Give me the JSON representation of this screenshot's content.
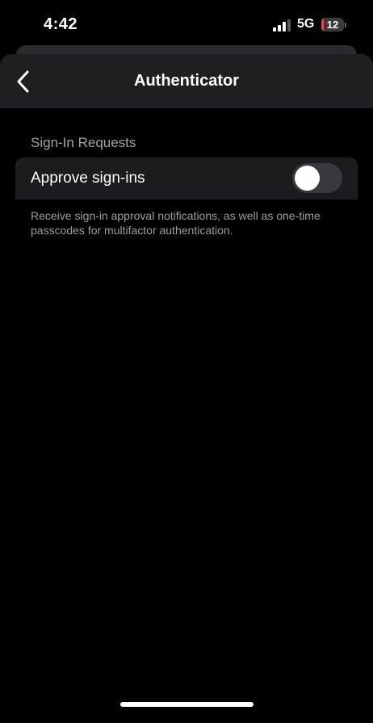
{
  "status_bar": {
    "time": "4:42",
    "network": "5G",
    "battery_level": "12",
    "battery_fraction": 0.12,
    "battery_color": "#e5484d",
    "signal_bars_active": 3,
    "signal_bars_total": 4
  },
  "nav": {
    "title": "Authenticator",
    "back_icon": "chevron-left-icon"
  },
  "section": {
    "header": "Sign-In Requests",
    "row_label": "Approve sign-ins",
    "toggle_on": false,
    "footer": "Receive sign-in approval notifications, as well as one-time passcodes for multifactor authentication."
  },
  "colors": {
    "background": "#000000",
    "nav_background": "#1f1f21",
    "row_background": "#1c1c1e",
    "toggle_off": "#39393d"
  }
}
